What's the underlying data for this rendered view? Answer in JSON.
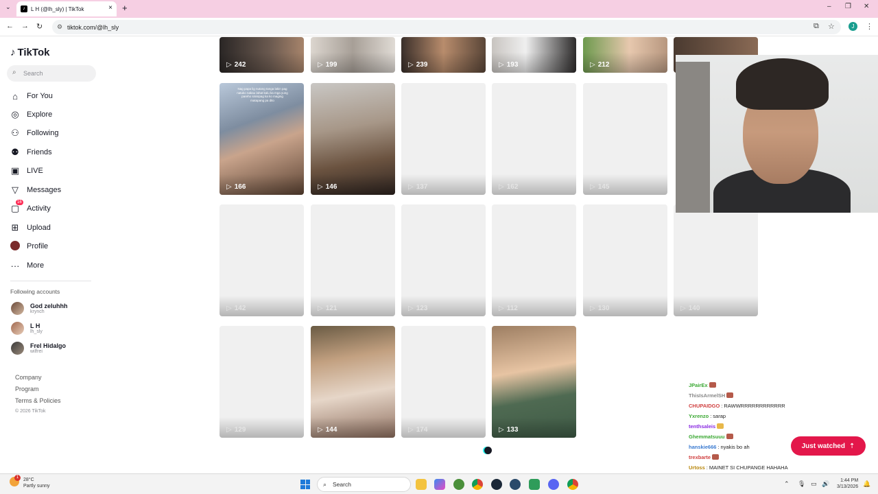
{
  "browser": {
    "tab_title": "L H (@lh_sly) | TikTok",
    "url": "tiktok.com/@lh_sly"
  },
  "sidebar": {
    "logo": "TikTok",
    "search_placeholder": "Search",
    "nav": [
      {
        "label": "For You",
        "icon": "home-icon"
      },
      {
        "label": "Explore",
        "icon": "compass-icon"
      },
      {
        "label": "Following",
        "icon": "following-icon"
      },
      {
        "label": "Friends",
        "icon": "friends-icon"
      },
      {
        "label": "LIVE",
        "icon": "live-icon"
      },
      {
        "label": "Messages",
        "icon": "messages-icon"
      },
      {
        "label": "Activity",
        "icon": "activity-icon",
        "badge": "16"
      },
      {
        "label": "Upload",
        "icon": "upload-icon"
      },
      {
        "label": "Profile",
        "icon": "profile-avatar"
      },
      {
        "label": "More",
        "icon": "more-icon"
      }
    ],
    "following_title": "Following accounts",
    "accounts": [
      {
        "name": "God zeluhhh",
        "handle": "krynch"
      },
      {
        "name": "L H",
        "handle": "lh_sly"
      },
      {
        "name": "Frel Hidalgo",
        "handle": "wilfrei"
      }
    ],
    "footer": [
      "Company",
      "Program",
      "Terms & Policies"
    ],
    "copyright": "© 2026 TikTok"
  },
  "videos": {
    "row1": [
      "242",
      "199",
      "239",
      "193",
      "212"
    ],
    "row2": [
      "166",
      "146",
      "137",
      "162",
      "145"
    ],
    "row3": [
      "142",
      "121",
      "123",
      "112",
      "130",
      "140"
    ],
    "row4": [
      "129",
      "144",
      "174",
      "133"
    ],
    "overlay_text": "Nag papa lig nutang tanga lakin pag natuko nakau lahat kalu ka mga yung pareho sinisipag ka ko maging matapang pa dito"
  },
  "chat": {
    "lines": [
      {
        "user": "JPairEx",
        "msg": ""
      },
      {
        "user": "ThisIsArmelSH",
        "msg": ""
      },
      {
        "user": "CHUPAIDGO",
        "msg": "RAWWRRRRRRRRRRRR"
      },
      {
        "user": "Yxrenzo",
        "msg": "sarap"
      },
      {
        "user": "tenthsaleis",
        "msg": ""
      },
      {
        "user": "Ghemmatsuuu",
        "msg": ""
      },
      {
        "user": "hanskie666",
        "msg": "nyakis bo ah"
      },
      {
        "user": "trexbarte",
        "msg": ""
      },
      {
        "user": "Urtoss",
        "msg": "MAINET SI CHUPANGE HAHAHA"
      }
    ],
    "just_watched": "Just watched"
  },
  "taskbar": {
    "temp": "28°C",
    "weather": "Partly sunny",
    "weather_badge": "1",
    "search": "Search",
    "time": "1:44 PM",
    "date": "3/13/2026"
  }
}
